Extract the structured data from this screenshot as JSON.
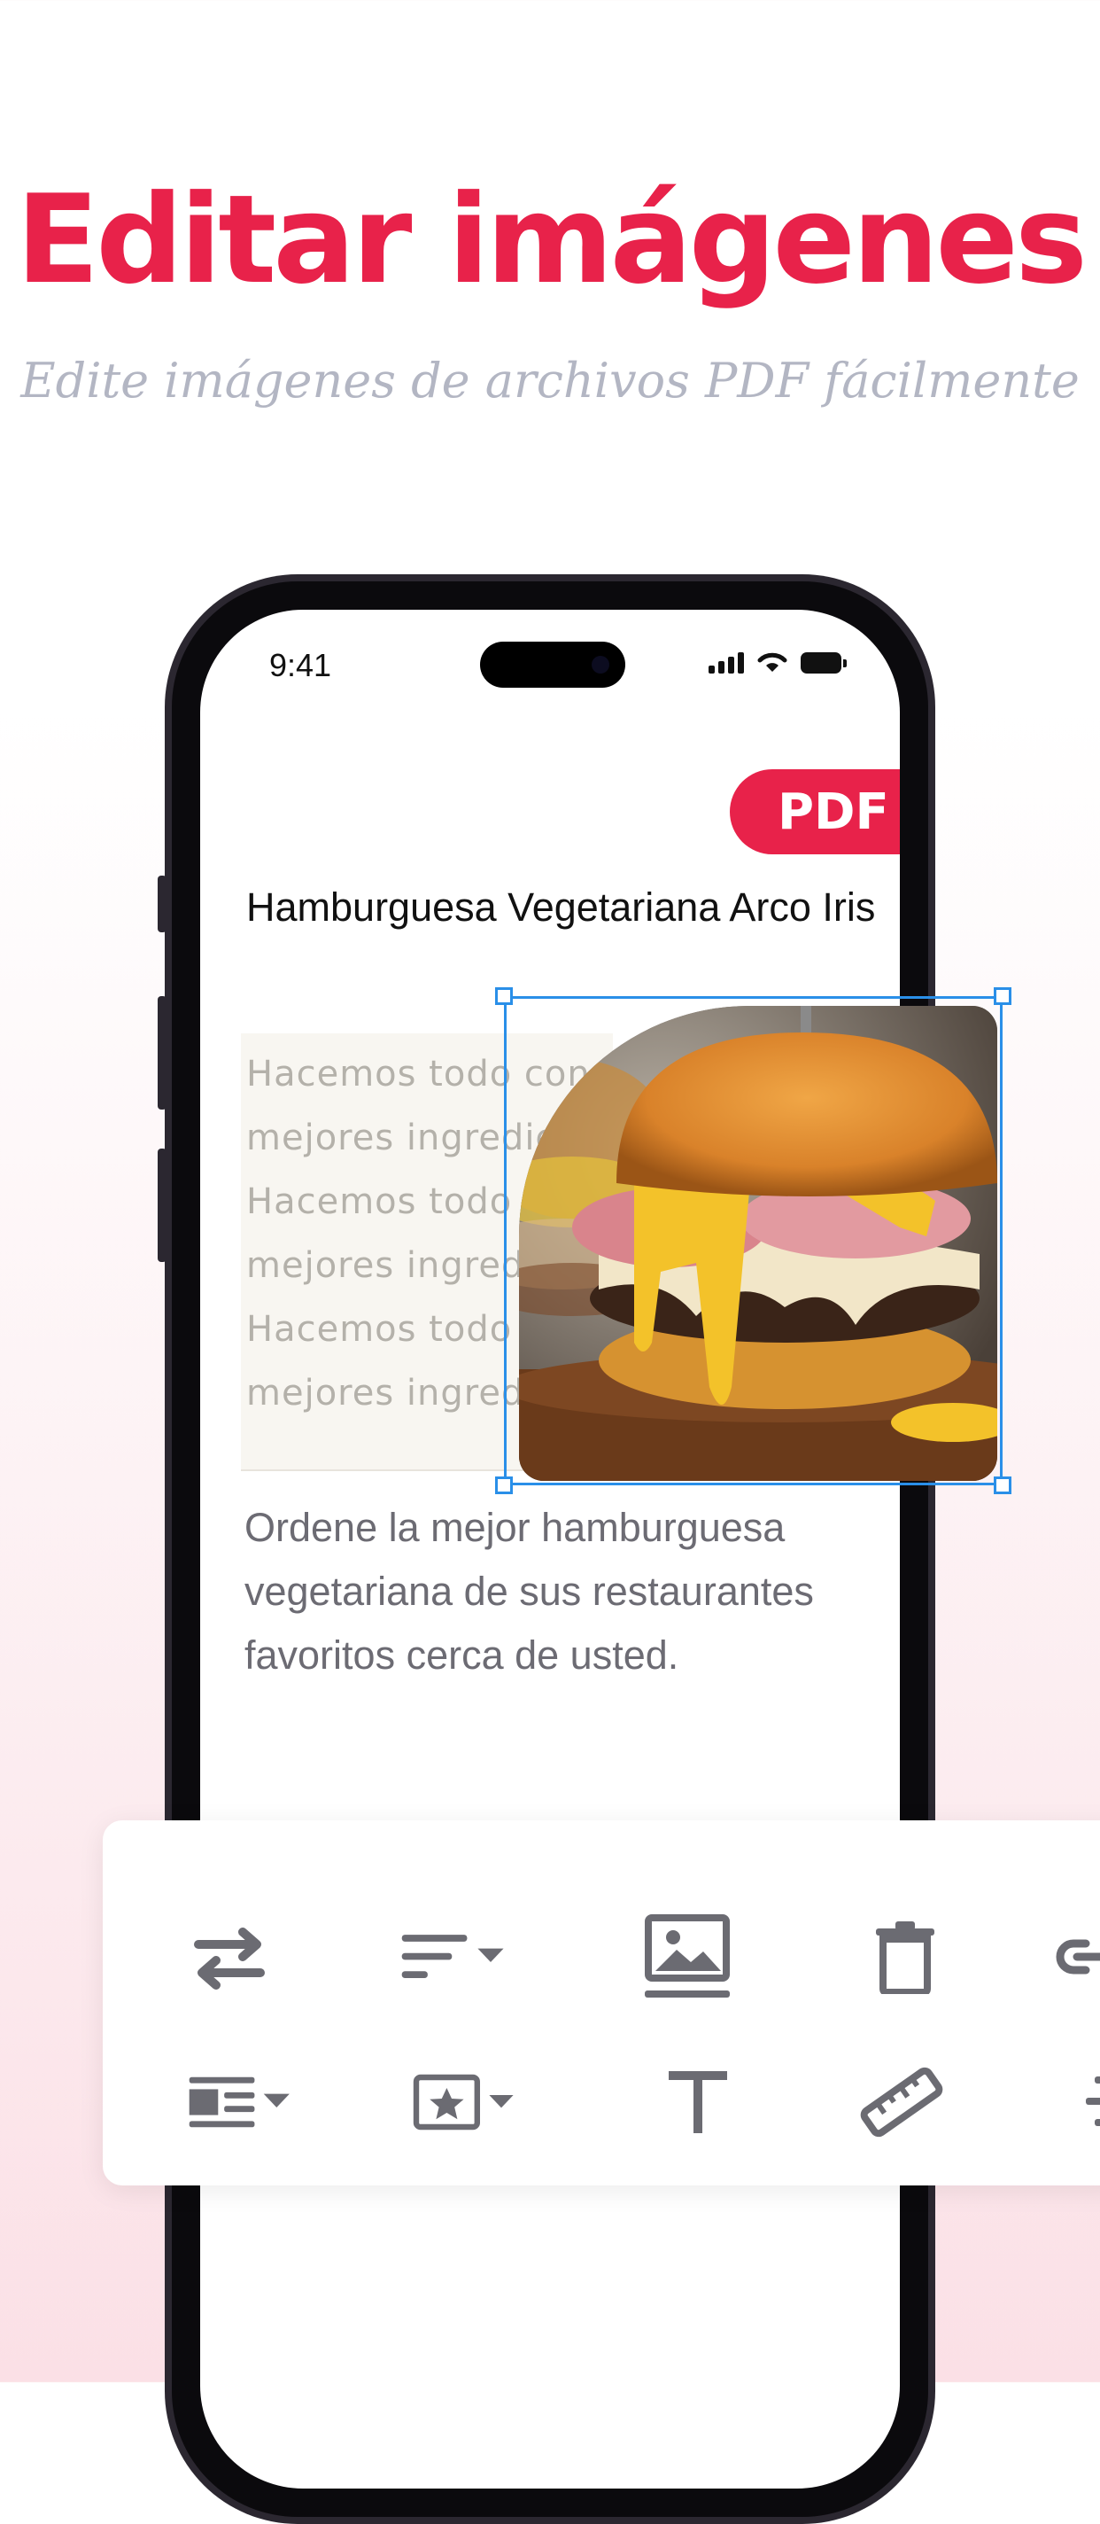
{
  "header": {
    "headline": "Editar imágenes",
    "subheadline": "Edite imágenes de archivos PDF fácilmente"
  },
  "status_bar": {
    "time": "9:41"
  },
  "document": {
    "badge": "PDF",
    "title": "Hamburguesa Vegetariana Arco Iris",
    "body_lines": [
      "Hacemos todo con los",
      "mejores ingredientes.",
      "Hacemos todo con los",
      "mejores ingredientes.",
      "Hacemos todo con los",
      "mejores ingredientes."
    ],
    "paragraph": "Ordene la mejor hamburguesa vegetariana de sus restaurantes favoritos cerca de usted."
  },
  "toolbar": {
    "row1": [
      "swap-icon",
      "align-icon",
      "image-icon",
      "trash-icon",
      "link-icon"
    ],
    "row2": [
      "text-wrap-icon",
      "stamp-icon",
      "text-icon",
      "ruler-icon",
      "indent-icon"
    ]
  },
  "colors": {
    "accent": "#e8224a",
    "selection": "#2a8fe8",
    "icon": "#6b6b72",
    "subhead": "#b3b6c3"
  }
}
